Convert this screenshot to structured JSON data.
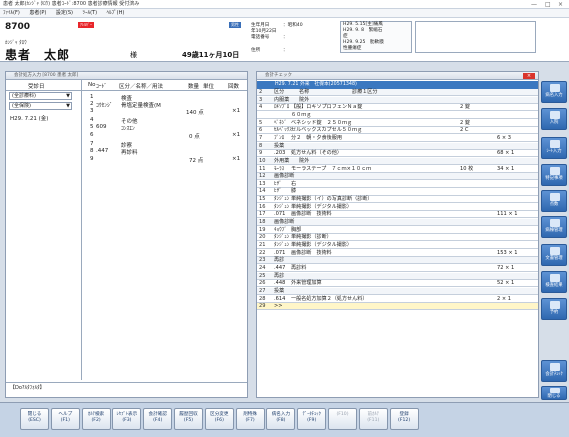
{
  "titlebar": {
    "title": "患者 太郎(ｶﾝｼﾞｬ ﾀﾛｳ) 患者ｺｰﾄﾞ:8700 患者診療情報 受付済み",
    "minimize": "—",
    "maximize": "□",
    "close": "×"
  },
  "menu": [
    "ﾌｧｲﾙ(F)",
    "患者(P)",
    "設定(S)",
    "ﾂｰﾙ(T)",
    "ﾍﾙﾌﾟ(H)"
  ],
  "patient": {
    "id": "8700",
    "allergy": "ｱﾚﾙｷﾞｰ",
    "kana": "ｶﾝｼﾞｬ ﾀﾛｳ",
    "name": "患者　太郎",
    "honorific": "様",
    "age": "49歳11ヶ月10日",
    "badge": "男性",
    "birth_label": "生年月日",
    "birth_value": "：昭和40",
    "birth_date": "年10月22日",
    "phone_label": "電話番号",
    "phone_value": "：",
    "address_label": "住所",
    "address_value": "：",
    "history": [
      "H29. 5.15[主]痛風",
      "H29. 9. 8　緊縮石",
      "症",
      "H29. 9.25　肋軟膜",
      "性腫瘍症"
    ]
  },
  "left": {
    "panel_title": "会計処方入力 [8700 患者 太郎]",
    "col_date": "受診日",
    "col_no": "No",
    "col_code": "ｺｰﾄﾞ",
    "col_name": "区分／名称／用法",
    "col_qty": "数量",
    "col_unit": "単位",
    "col_times": "回数",
    "filter1": "(全診療科)",
    "filter2": "(全保険)",
    "visit_date": "H29. 7.21 (金)",
    "filter_button": "【Do?ﾙﾀﾌｫﾙﾀ】",
    "items": [
      {
        "no": "1",
        "code": "",
        "name": "検査",
        "qty": "",
        "times": ""
      },
      {
        "no": "2",
        "code": "ｺｳｾﾝｼﾞ",
        "name": "骨塩定量検査(M",
        "qty": "",
        "times": ""
      },
      {
        "no": "3",
        "code": "",
        "name": "",
        "qty": "140 点",
        "times": "×1"
      },
      {
        "no": "4",
        "code": "",
        "name": "その他",
        "qty": "",
        "times": ""
      },
      {
        "no": "5",
        "code": "609",
        "name": "ｺﾝｽｴﾝ",
        "qty": "",
        "times": ""
      },
      {
        "no": "6",
        "code": "",
        "name": "",
        "qty": "0 点",
        "times": "×1"
      },
      {
        "no": "7",
        "code": "",
        "name": "診察",
        "qty": "",
        "times": ""
      },
      {
        "no": "8",
        "code": ".447",
        "name": "再診料",
        "qty": "",
        "times": ""
      },
      {
        "no": "9",
        "code": "",
        "name": "",
        "qty": "72 点",
        "times": "×1"
      }
    ]
  },
  "right": {
    "panel_title": "会計チェック",
    "header_text": "H29. 7.21 外来　社保本(20571348)",
    "rows": [
      {
        "n": "2",
        "c1": "区分",
        "c2": "名称",
        "c3": "診療１区分",
        "qty": "",
        "x": "",
        "group": true
      },
      {
        "n": "3",
        "c1": "内服薬",
        "c2": "院外",
        "c3": "",
        "qty": "",
        "x": "",
        "group": true
      },
      {
        "n": "4",
        "c1": "ﾛｷｿﾌﾟﾛ",
        "c2": "【般】ロキソプロフェンＮａ錠",
        "c3": "",
        "qty": "2 錠",
        "x": "",
        "group": false
      },
      {
        "n": "",
        "c1": "",
        "c2": "６０ｍｇ",
        "c3": "",
        "qty": "",
        "x": "",
        "group": false
      },
      {
        "n": "5",
        "c1": "ﾍﾞﾈｼﾞ",
        "c2": "ベネシッド錠　２５０ｍｇ",
        "c3": "",
        "qty": "2 錠",
        "x": "",
        "group": false
      },
      {
        "n": "6",
        "c1": "ｾﾙﾍﾞｯｸｽ",
        "c2": "セルベックスカプセル５０ｍｇ",
        "c3": "",
        "qty": "2 C",
        "x": "",
        "group": false
      },
      {
        "n": "7",
        "c1": "ﾌﾞﾝﾛ",
        "c2": "分２　朝・夕食後服用",
        "c3": "",
        "qty": "",
        "x": "6 × 3",
        "group": false
      },
      {
        "n": "8",
        "c1": "投薬",
        "c2": "",
        "c3": "",
        "qty": "",
        "x": "",
        "group": true
      },
      {
        "n": "9",
        "c1": ".203",
        "c2": "処方せん料（その他）",
        "c3": "",
        "qty": "",
        "x": "68 × 1",
        "group": false
      },
      {
        "n": "10",
        "c1": "外用薬",
        "c2": "院外",
        "c3": "",
        "qty": "",
        "x": "",
        "group": true
      },
      {
        "n": "11",
        "c1": "ﾓｰﾗｽ",
        "c2": "モーラステープ　７ｃｍ×１０ｃｍ",
        "c3": "",
        "qty": "10 枚",
        "x": "34 × 1",
        "group": false
      },
      {
        "n": "12",
        "c1": "画像診断",
        "c2": "",
        "c3": "",
        "qty": "",
        "x": "",
        "group": true
      },
      {
        "n": "13",
        "c1": "ﾋｻﾞ",
        "c2": "右",
        "c3": "",
        "qty": "",
        "x": "",
        "group": false
      },
      {
        "n": "14",
        "c1": "ﾋｻﾞ",
        "c2": "膝",
        "c3": "",
        "qty": "",
        "x": "",
        "group": false
      },
      {
        "n": "15",
        "c1": "ﾀﾝｼﾞｭﾝ",
        "c2": "単純撮影（イ）の写真診断（診断）",
        "c3": "",
        "qty": "",
        "x": "",
        "group": false
      },
      {
        "n": "16",
        "c1": "ﾀﾝｼﾞｭﾝ",
        "c2": "単純撮影（デジタル撮影）",
        "c3": "",
        "qty": "",
        "x": "",
        "group": false
      },
      {
        "n": "17",
        "c1": ".071",
        "c2": "画像診断　技術料",
        "c3": "",
        "qty": "",
        "x": "111 × 1",
        "group": false
      },
      {
        "n": "18",
        "c1": "画像診断",
        "c2": "",
        "c3": "",
        "qty": "",
        "x": "",
        "group": true
      },
      {
        "n": "19",
        "c1": "ｷｮｳﾌﾞ",
        "c2": "胸部",
        "c3": "",
        "qty": "",
        "x": "",
        "group": false
      },
      {
        "n": "20",
        "c1": "ﾀﾝｼﾞｭﾝ",
        "c2": "単純撮影（診断）",
        "c3": "",
        "qty": "",
        "x": "",
        "group": false
      },
      {
        "n": "21",
        "c1": "ﾀﾝｼﾞｭﾝ",
        "c2": "単純撮影（デジタル撮影）",
        "c3": "",
        "qty": "",
        "x": "",
        "group": false
      },
      {
        "n": "22",
        "c1": ".071",
        "c2": "画像診断　技術料",
        "c3": "",
        "qty": "",
        "x": "153 × 1",
        "group": false
      },
      {
        "n": "23",
        "c1": "再診",
        "c2": "",
        "c3": "",
        "qty": "",
        "x": "",
        "group": true
      },
      {
        "n": "24",
        "c1": ".447",
        "c2": "再診料",
        "c3": "",
        "qty": "",
        "x": "72 × 1",
        "group": false
      },
      {
        "n": "25",
        "c1": "再診",
        "c2": "",
        "c3": "",
        "qty": "",
        "x": "",
        "group": true
      },
      {
        "n": "26",
        "c1": ".448",
        "c2": "外来管理加算",
        "c3": "",
        "qty": "",
        "x": "52 × 1",
        "group": false
      },
      {
        "n": "27",
        "c1": "投薬",
        "c2": "",
        "c3": "",
        "qty": "",
        "x": "",
        "group": true
      },
      {
        "n": "28",
        "c1": ".614",
        "c2": "一般名処方加算２（処方せん料）",
        "c3": "",
        "qty": "",
        "x": "2 × 1",
        "group": false
      },
      {
        "n": "29",
        "c1": ">>",
        "c2": "",
        "c3": "",
        "qty": "",
        "x": "",
        "group": false,
        "highlight": true
      }
    ]
  },
  "sidebar": [
    "病名入力",
    "入院",
    "ｼｰﾄ入力",
    "特記事項",
    "点数",
    "病棟管理",
    "文書管理",
    "検査結果",
    "予約",
    "会計ﾁｪｯｸ",
    "閉じる"
  ],
  "fkeys": [
    {
      "label": "閉じる",
      "key": "(ESC)",
      "dim": false
    },
    {
      "label": "ヘルプ",
      "key": "(F1)",
      "dim": false
    },
    {
      "label": "ｶﾙﾃ検索",
      "key": "(F2)",
      "dim": false
    },
    {
      "label": "ﾚｾﾌﾟﾄ表示",
      "key": "(F3)",
      "dim": false
    },
    {
      "label": "会計確認",
      "key": "(F4)",
      "dim": false
    },
    {
      "label": "履歴回収",
      "key": "(F5)",
      "dim": false
    },
    {
      "label": "区分変更",
      "key": "(F6)",
      "dim": false
    },
    {
      "label": "剤特殊",
      "key": "(F7)",
      "dim": false
    },
    {
      "label": "病名入力",
      "key": "(F8)",
      "dim": false
    },
    {
      "label": "ﾃﾞｰﾀﾁｪｯｸ",
      "key": "(F9)",
      "dim": false
    },
    {
      "label": "",
      "key": "(F10)",
      "dim": true
    },
    {
      "label": "前ｶﾙﾃ",
      "key": "(F11)",
      "dim": true
    },
    {
      "label": "登録",
      "key": "(F12)",
      "dim": false
    }
  ]
}
